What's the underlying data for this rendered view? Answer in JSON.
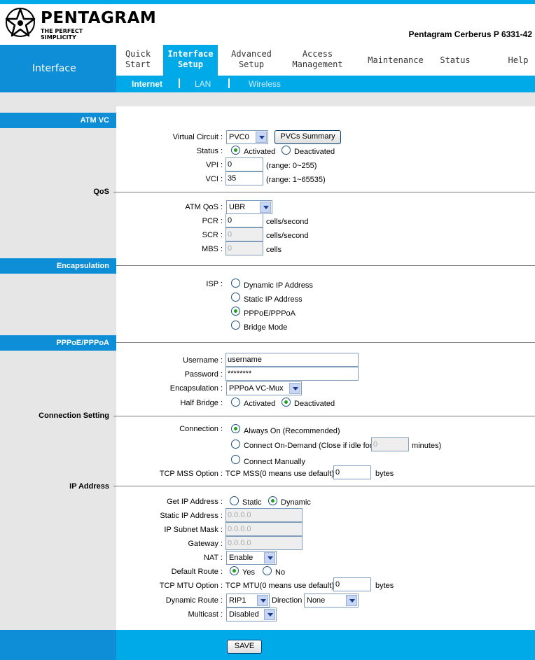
{
  "brand": {
    "logo_text": "PENTAGRAM",
    "logo_tagline": "THE PERFECT SIMPLICITY",
    "model": "Pentagram Cerberus P 6331-42"
  },
  "nav": {
    "section_label": "Interface",
    "items": [
      {
        "label": "Quick\nStart"
      },
      {
        "label": "Interface\nSetup"
      },
      {
        "label": "Advanced\nSetup"
      },
      {
        "label": "Access\nManagement"
      },
      {
        "label": "Maintenance"
      },
      {
        "label": "Status"
      },
      {
        "label": "Help"
      }
    ],
    "subtabs": [
      "Internet",
      "LAN",
      "Wireless"
    ]
  },
  "atm_vc": {
    "title": "ATM VC",
    "virtual_circuit_label": "Virtual Circuit :",
    "virtual_circuit_value": "PVC0",
    "pvcs_summary_button": "PVCs Summary",
    "status_label": "Status :",
    "status_activated": "Activated",
    "status_deactivated": "Deactivated",
    "vpi_label": "VPI :",
    "vpi_value": "0",
    "vpi_range": "(range: 0~255)",
    "vci_label": "VCI :",
    "vci_value": "35",
    "vci_range": "(range: 1~65535)"
  },
  "qos": {
    "title": "QoS",
    "atm_qos_label": "ATM QoS :",
    "atm_qos_value": "UBR",
    "pcr_label": "PCR :",
    "pcr_value": "0",
    "pcr_unit": "cells/second",
    "scr_label": "SCR :",
    "scr_value": "0",
    "scr_unit": "cells/second",
    "mbs_label": "MBS :",
    "mbs_value": "0",
    "mbs_unit": "cells"
  },
  "encapsulation": {
    "title": "Encapsulation",
    "isp_label": "ISP :",
    "options": [
      "Dynamic IP Address",
      "Static IP Address",
      "PPPoE/PPPoA",
      "Bridge Mode"
    ]
  },
  "pppoe": {
    "title": "PPPoE/PPPoA",
    "username_label": "Username :",
    "username_value": "username",
    "password_label": "Password :",
    "password_value": "********",
    "encap_label": "Encapsulation :",
    "encap_value": "PPPoA VC-Mux",
    "half_bridge_label": "Half Bridge :",
    "half_bridge_activated": "Activated",
    "half_bridge_deactivated": "Deactivated"
  },
  "connection": {
    "title": "Connection Setting",
    "connection_label": "Connection :",
    "always_on": "Always On (Recommended)",
    "on_demand": "Connect On-Demand (Close if idle for",
    "on_demand_value": "0",
    "on_demand_unit": "minutes)",
    "manually": "Connect Manually",
    "tcp_mss_label": "TCP MSS Option :",
    "tcp_mss_text": "TCP MSS(0 means use default)",
    "tcp_mss_value": "0",
    "tcp_mss_unit": "bytes"
  },
  "ip_address": {
    "title": "IP Address",
    "get_ip_label": "Get IP Address :",
    "get_ip_static": "Static",
    "get_ip_dynamic": "Dynamic",
    "static_ip_label": "Static IP Address :",
    "static_ip_value": "0.0.0.0",
    "subnet_label": "IP Subnet Mask :",
    "subnet_value": "0.0.0.0",
    "gateway_label": "Gateway :",
    "gateway_value": "0.0.0.0",
    "nat_label": "NAT :",
    "nat_value": "Enable",
    "default_route_label": "Default Route :",
    "default_route_yes": "Yes",
    "default_route_no": "No",
    "tcp_mtu_label": "TCP MTU Option :",
    "tcp_mtu_text": "TCP MTU(0 means use default)",
    "tcp_mtu_value": "0",
    "tcp_mtu_unit": "bytes",
    "dynamic_route_label": "Dynamic Route :",
    "dynamic_route_value": "RIP1",
    "direction_label": "Direction",
    "direction_value": "None",
    "multicast_label": "Multicast :",
    "multicast_value": "Disabled"
  },
  "footer": {
    "save_button": "SAVE"
  },
  "colors": {
    "nav_blue": "#0e8ed6",
    "accent_cyan": "#00a9e8",
    "panel_gray": "#e6e6e6"
  }
}
